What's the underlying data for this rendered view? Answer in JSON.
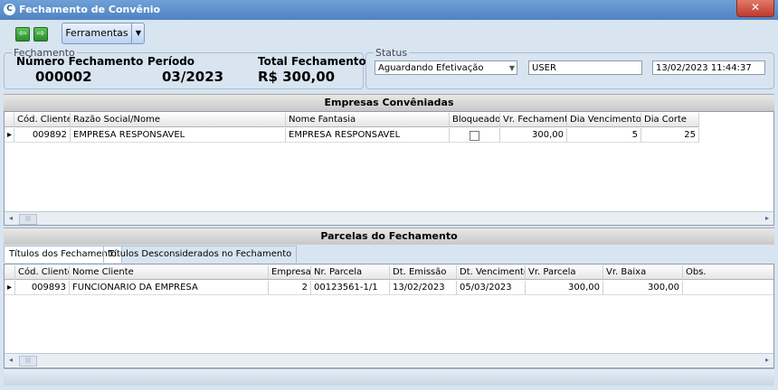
{
  "window": {
    "title": "Fechamento de Convênio",
    "close_glyph": "✕",
    "icon_letter": "C"
  },
  "toolbar": {
    "back_icon": "arrow-left-icon",
    "forward_icon": "arrow-right-icon",
    "back_glyph": "⇦",
    "forward_glyph": "⇨",
    "tools_label": "Ferramentas",
    "tools_caret": "▼"
  },
  "summary": {
    "legend": "Fechamento",
    "numero_label": "Número Fechamento",
    "numero_value": "000002",
    "periodo_label": "Período",
    "periodo_value": "03/2023",
    "total_label": "Total Fechamento",
    "total_value": "R$ 300,00"
  },
  "status": {
    "legend": "Status",
    "status_value": "Aguardando Efetivação",
    "status_caret": "▼",
    "user_value": "USER",
    "datetime_value": "13/02/2023 11:44:37"
  },
  "empresas": {
    "title": "Empresas Convêniadas",
    "headers": [
      "Cód. Cliente",
      "Razão Social/Nome",
      "Nome Fantasia",
      "Bloqueado",
      "Vr. Fechamento",
      "Dia Vencimento",
      "Dia Corte"
    ],
    "rows": [
      {
        "indicator": "▸",
        "cod": "009892",
        "razao": "EMPRESA RESPONSAVEL",
        "fantasia": "EMPRESA RESPONSAVEL",
        "bloqueado": false,
        "vr_fechamento": "300,00",
        "dia_vencimento": "5",
        "dia_corte": "25"
      }
    ],
    "scroll_left": "◂",
    "scroll_right": "▸",
    "scroll_grip": "|||"
  },
  "parcelas": {
    "title": "Parcelas do Fechamento",
    "tabs": [
      "Títulos dos Fechamento",
      "Títulos Desconsiderados no Fechamento"
    ],
    "headers": [
      "Cód. Cliente",
      "Nome Cliente",
      "Empresa",
      "Nr. Parcela",
      "Dt. Emissão",
      "Dt. Vencimento",
      "Vr. Parcela",
      "Vr. Baixa",
      "Obs."
    ],
    "rows": [
      {
        "indicator": "▸",
        "cod": "009893",
        "nome": "FUNCIONARIO DA EMPRESA",
        "empresa": "2",
        "nr_parcela": "00123561-1/1",
        "dt_emissao": "13/02/2023",
        "dt_vencimento": "05/03/2023",
        "vr_parcela": "300,00",
        "vr_baixa": "300,00",
        "obs": ""
      }
    ],
    "scroll_left": "◂",
    "scroll_right": "▸",
    "scroll_grip": "|||"
  }
}
